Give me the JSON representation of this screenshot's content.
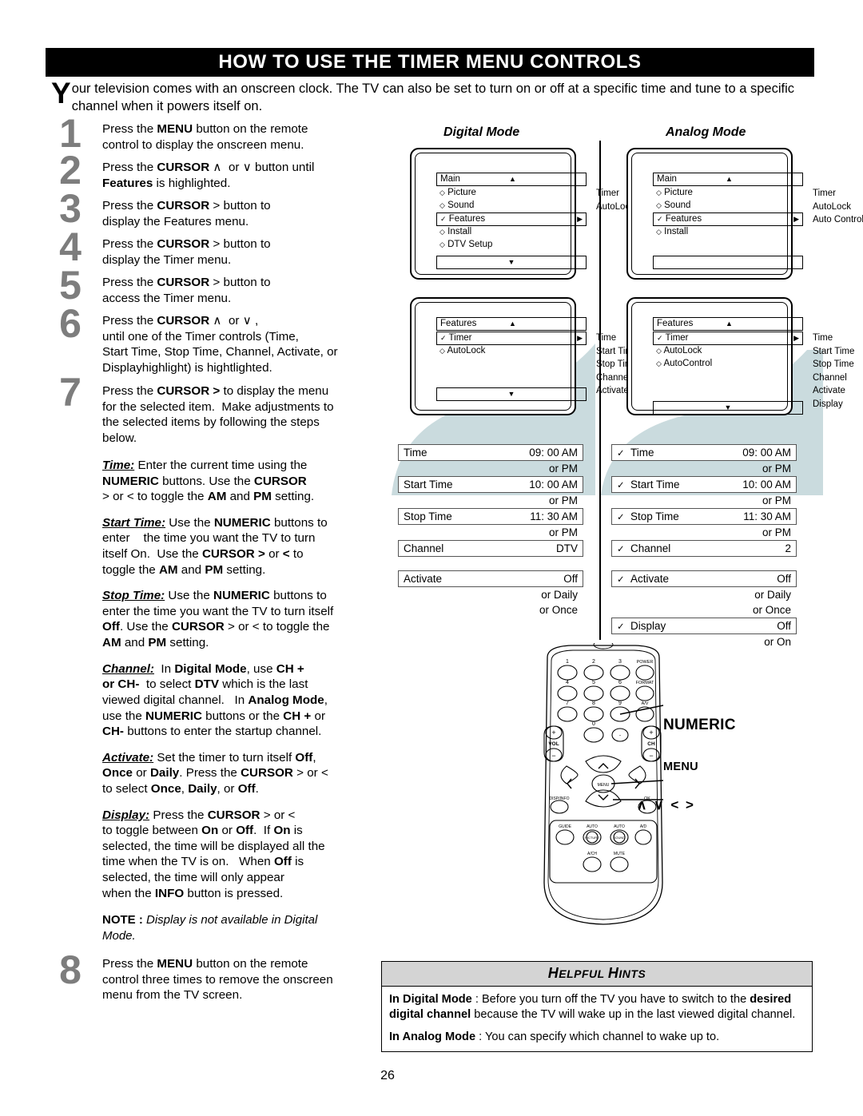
{
  "page": {
    "title": "HOW TO USE THE TIMER MENU CONTROLS",
    "intro_dropcap": "Y",
    "intro": "our television comes with an onscreen clock. The TV can also be set to turn on or off at a specific time and tune to a specific channel when it powers itself on.",
    "page_number": "26"
  },
  "steps": [
    {
      "num": "1",
      "text_parts": [
        "Press the ",
        "MENU",
        " button on the remote control to display the onscreen menu."
      ]
    },
    {
      "num": "2",
      "text_parts": [
        "Press the ",
        "CURSOR",
        " ∧  or ∨ button until ",
        "Features",
        " is highlighted."
      ]
    },
    {
      "num": "3",
      "text_parts": [
        "Press the ",
        "CURSOR",
        " > button to display the Features menu."
      ]
    },
    {
      "num": "4",
      "text_parts": [
        "Press the ",
        "CURSOR",
        " > button to display the Timer menu."
      ]
    },
    {
      "num": "5",
      "text_parts": [
        "Press the ",
        "CURSOR",
        " > button to access the Timer menu."
      ]
    },
    {
      "num": "6",
      "text_parts": [
        "Press the ",
        "CURSOR",
        " ∧  or ∨ , until one of the Timer controls (Time, Start Time, Stop Time, Channel, Activate, or Displayhighlight) is hightlighted."
      ]
    },
    {
      "num": "7",
      "text_parts": [
        "Press the ",
        "CURSOR >",
        " to display the menu for the selected item.  Make adjustments to the selected items by following the steps below."
      ]
    },
    {
      "num": "8",
      "text_parts": [
        "Press the ",
        "MENU",
        " button on the remote control three times to remove the onscreen menu from the TV screen."
      ]
    }
  ],
  "settings": [
    {
      "lead": "Time:",
      "text": " Enter the current time using the NUMERIC buttons. Use the CURSOR > or < to toggle the AM and PM setting."
    },
    {
      "lead": "Start Time:",
      "text": " Use the NUMERIC buttons to enter    the time you want the TV to turn itself On.  Use the CURSOR > or < to toggle the AM and PM setting."
    },
    {
      "lead": "Stop Time:",
      "text": " Use the NUMERIC buttons to enter the time you want the TV to turn itself Off. Use the CURSOR > or < to toggle the AM and PM setting."
    },
    {
      "lead": "Channel:",
      "text": "  In Digital Mode, use CH + or CH-  to select DTV which is the last viewed digital channel.   In Analog Mode, use the NUMERIC buttons or the CH + or CH- buttons to enter the startup channel."
    },
    {
      "lead": "Activate:",
      "text": " Set the timer to turn itself Off, Once or Daily. Press the CURSOR > or < to select Once, Daily, or Off."
    },
    {
      "lead": "Display:",
      "text": " Press the CURSOR > or < to toggle between On or Off.  If On is selected, the time will be displayed all the time when the TV is on.   When Off is selected, the time will only appear when the INFO button is pressed."
    }
  ],
  "note": {
    "label": "NOTE :",
    "text": " Display is not available in Digital Mode."
  },
  "digital": {
    "title": "Digital Mode",
    "main_menu": {
      "header": "Main",
      "up_arrow": "▲",
      "down_arrow": "▼",
      "items": [
        {
          "marker": "◇",
          "label": "Picture",
          "selected": false
        },
        {
          "marker": "◇",
          "label": "Sound",
          "selected": false
        },
        {
          "marker": "✓",
          "label": "Features",
          "selected": true,
          "caret": "▶"
        },
        {
          "marker": "◇",
          "label": "Install",
          "selected": false
        },
        {
          "marker": "◇",
          "label": "DTV Setup",
          "selected": false
        }
      ],
      "submenu": [
        "Timer",
        "AutoLock"
      ]
    },
    "features_menu": {
      "header": "Features",
      "up_arrow": "▲",
      "down_arrow": "▼",
      "items": [
        {
          "marker": "✓",
          "label": "Timer",
          "selected": true,
          "caret": "▶"
        },
        {
          "marker": "◇",
          "label": "AutoLock",
          "selected": false
        }
      ],
      "submenu": [
        "Time",
        "Start Time",
        "Stop Time",
        "Channel",
        "Activate"
      ]
    },
    "timer_rows": [
      {
        "check": "",
        "label": "Time",
        "value": "09: 00 AM",
        "alt": "or PM"
      },
      {
        "check": "",
        "label": "Start Time",
        "value": "10: 00 AM",
        "alt": "or PM"
      },
      {
        "check": "",
        "label": "Stop Time",
        "value": "11: 30 AM",
        "alt": "or PM"
      },
      {
        "check": "",
        "label": "Channel",
        "value": "DTV",
        "alt": ""
      },
      {
        "check": "",
        "label": "Activate",
        "value": "Off",
        "alt": "or Daily",
        "alt2": "or Once"
      }
    ]
  },
  "analog": {
    "title": "Analog Mode",
    "main_menu": {
      "header": "Main",
      "up_arrow": "▲",
      "down_arrow": "",
      "items": [
        {
          "marker": "◇",
          "label": "Picture",
          "selected": false
        },
        {
          "marker": "◇",
          "label": "Sound",
          "selected": false
        },
        {
          "marker": "✓",
          "label": "Features",
          "selected": true,
          "caret": "▶"
        },
        {
          "marker": "◇",
          "label": "Install",
          "selected": false
        }
      ],
      "submenu": [
        "Timer",
        "AutoLock",
        "Auto Control"
      ]
    },
    "features_menu": {
      "header": "Features",
      "up_arrow": "▲",
      "down_arrow": "▼",
      "items": [
        {
          "marker": "✓",
          "label": "Timer",
          "selected": true,
          "caret": "▶"
        },
        {
          "marker": "◇",
          "label": "AutoLock",
          "selected": false
        },
        {
          "marker": "◇",
          "label": "AutoControl",
          "selected": false
        }
      ],
      "submenu": [
        "Time",
        "Start Time",
        "Stop Time",
        "Channel",
        "Activate",
        "Display"
      ]
    },
    "timer_rows": [
      {
        "check": "✓",
        "label": "Time",
        "value": "09: 00 AM",
        "alt": "or PM"
      },
      {
        "check": "✓",
        "label": "Start Time",
        "value": "10: 00 AM",
        "alt": "or PM"
      },
      {
        "check": "✓",
        "label": "Stop Time",
        "value": "11: 30 AM",
        "alt": "or PM"
      },
      {
        "check": "✓",
        "label": "Channel",
        "value": "2",
        "alt": ""
      },
      {
        "check": "✓",
        "label": "Activate",
        "value": "Off",
        "alt": "or Daily",
        "alt2": "or Once"
      },
      {
        "check": "✓",
        "label": "Display",
        "value": "Off",
        "alt": "or On"
      }
    ]
  },
  "remote": {
    "callouts": {
      "numeric": "NUMERIC",
      "menu": "MENU",
      "arrows": "∧ ∨ < >"
    },
    "keys": {
      "row1": [
        "1",
        "2",
        "3",
        "POWER"
      ],
      "row2": [
        "4",
        "5",
        "6",
        "FORMAT"
      ],
      "row3": [
        "7",
        "8",
        "9",
        "A/V"
      ],
      "row4": [
        "0",
        "·"
      ],
      "vol": "VOL",
      "ch": "CH",
      "plus": "+",
      "minus": "−",
      "menu": "MENU",
      "ok": "OK",
      "disp_info": "DISP/INFO",
      "bottom1": [
        "GUIDE",
        "AUTO PICTURE",
        "AUTO SOUND",
        "A/D"
      ],
      "bottom2": [
        "A/CH",
        "MUTE"
      ]
    }
  },
  "hints": {
    "heading_1": "H",
    "heading_2": "ELPFUL ",
    "heading_3": "H",
    "heading_4": "INTS",
    "items": [
      {
        "bold": "In Digital Mode",
        "sep": " :  Before you turn off the TV you have to switch to the ",
        "bold2": "desired digital channel",
        "rest": " because the TV will wake up in the last viewed digital channel."
      },
      {
        "bold": "In Analog Mode",
        "sep": "  :  You can specify which channel to wake up to.",
        "bold2": "",
        "rest": ""
      }
    ]
  },
  "colors": {
    "accent": "#7d7d7d",
    "wave": "#cadbde",
    "hints_header": "#d4d4d4"
  }
}
